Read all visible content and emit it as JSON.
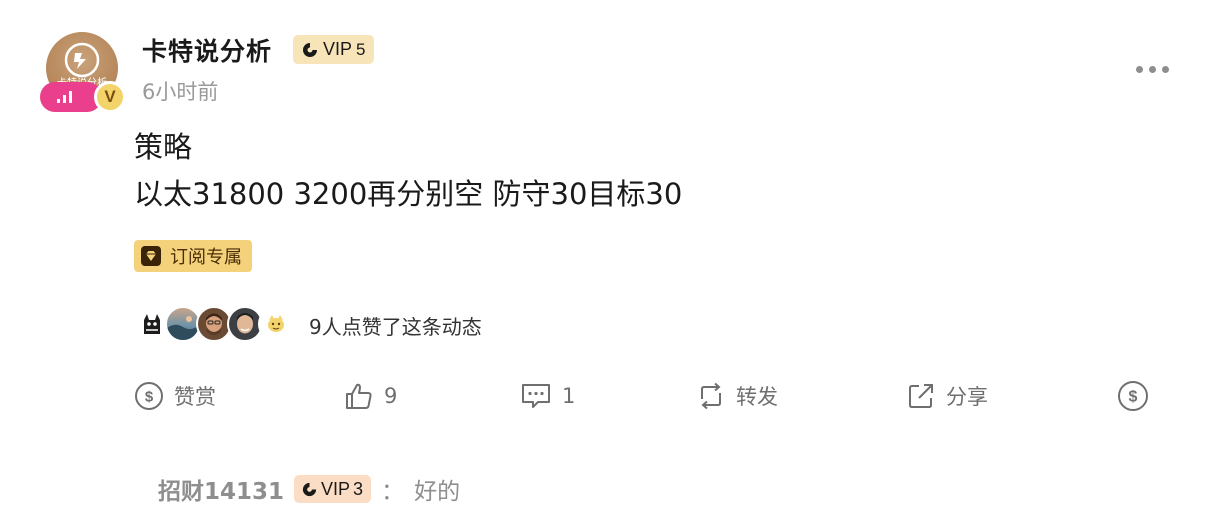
{
  "author": {
    "name": "卡特说分析",
    "vip_label": "VIP",
    "vip_level": "5",
    "time": "6小时前",
    "verified_mark": "V",
    "avatar_text": "卡特说分析"
  },
  "post": {
    "lines": [
      "策略",
      "以太31800  3200再分别空 防守30目标30"
    ],
    "tag_label": "订阅专属"
  },
  "likes": {
    "text": "9人点赞了这条动态",
    "avatars": [
      "cat-avatar",
      "landscape-avatar",
      "man-avatar",
      "smiling-man-avatar",
      "mascot-avatar"
    ]
  },
  "actions": {
    "reward_label": "赞赏",
    "like_count": "9",
    "comment_count": "1",
    "repost_label": "转发",
    "share_label": "分享"
  },
  "comment": {
    "user": "招财14131",
    "vip_label": "VIP",
    "vip_level": "3",
    "separator": "：",
    "text": "好的"
  },
  "colors": {
    "vip_badge_bg": "#f7e4b8",
    "tag_bg": "#f4d27c",
    "live_badge": "#ea3f8c",
    "muted_text": "#9a9a9a"
  }
}
